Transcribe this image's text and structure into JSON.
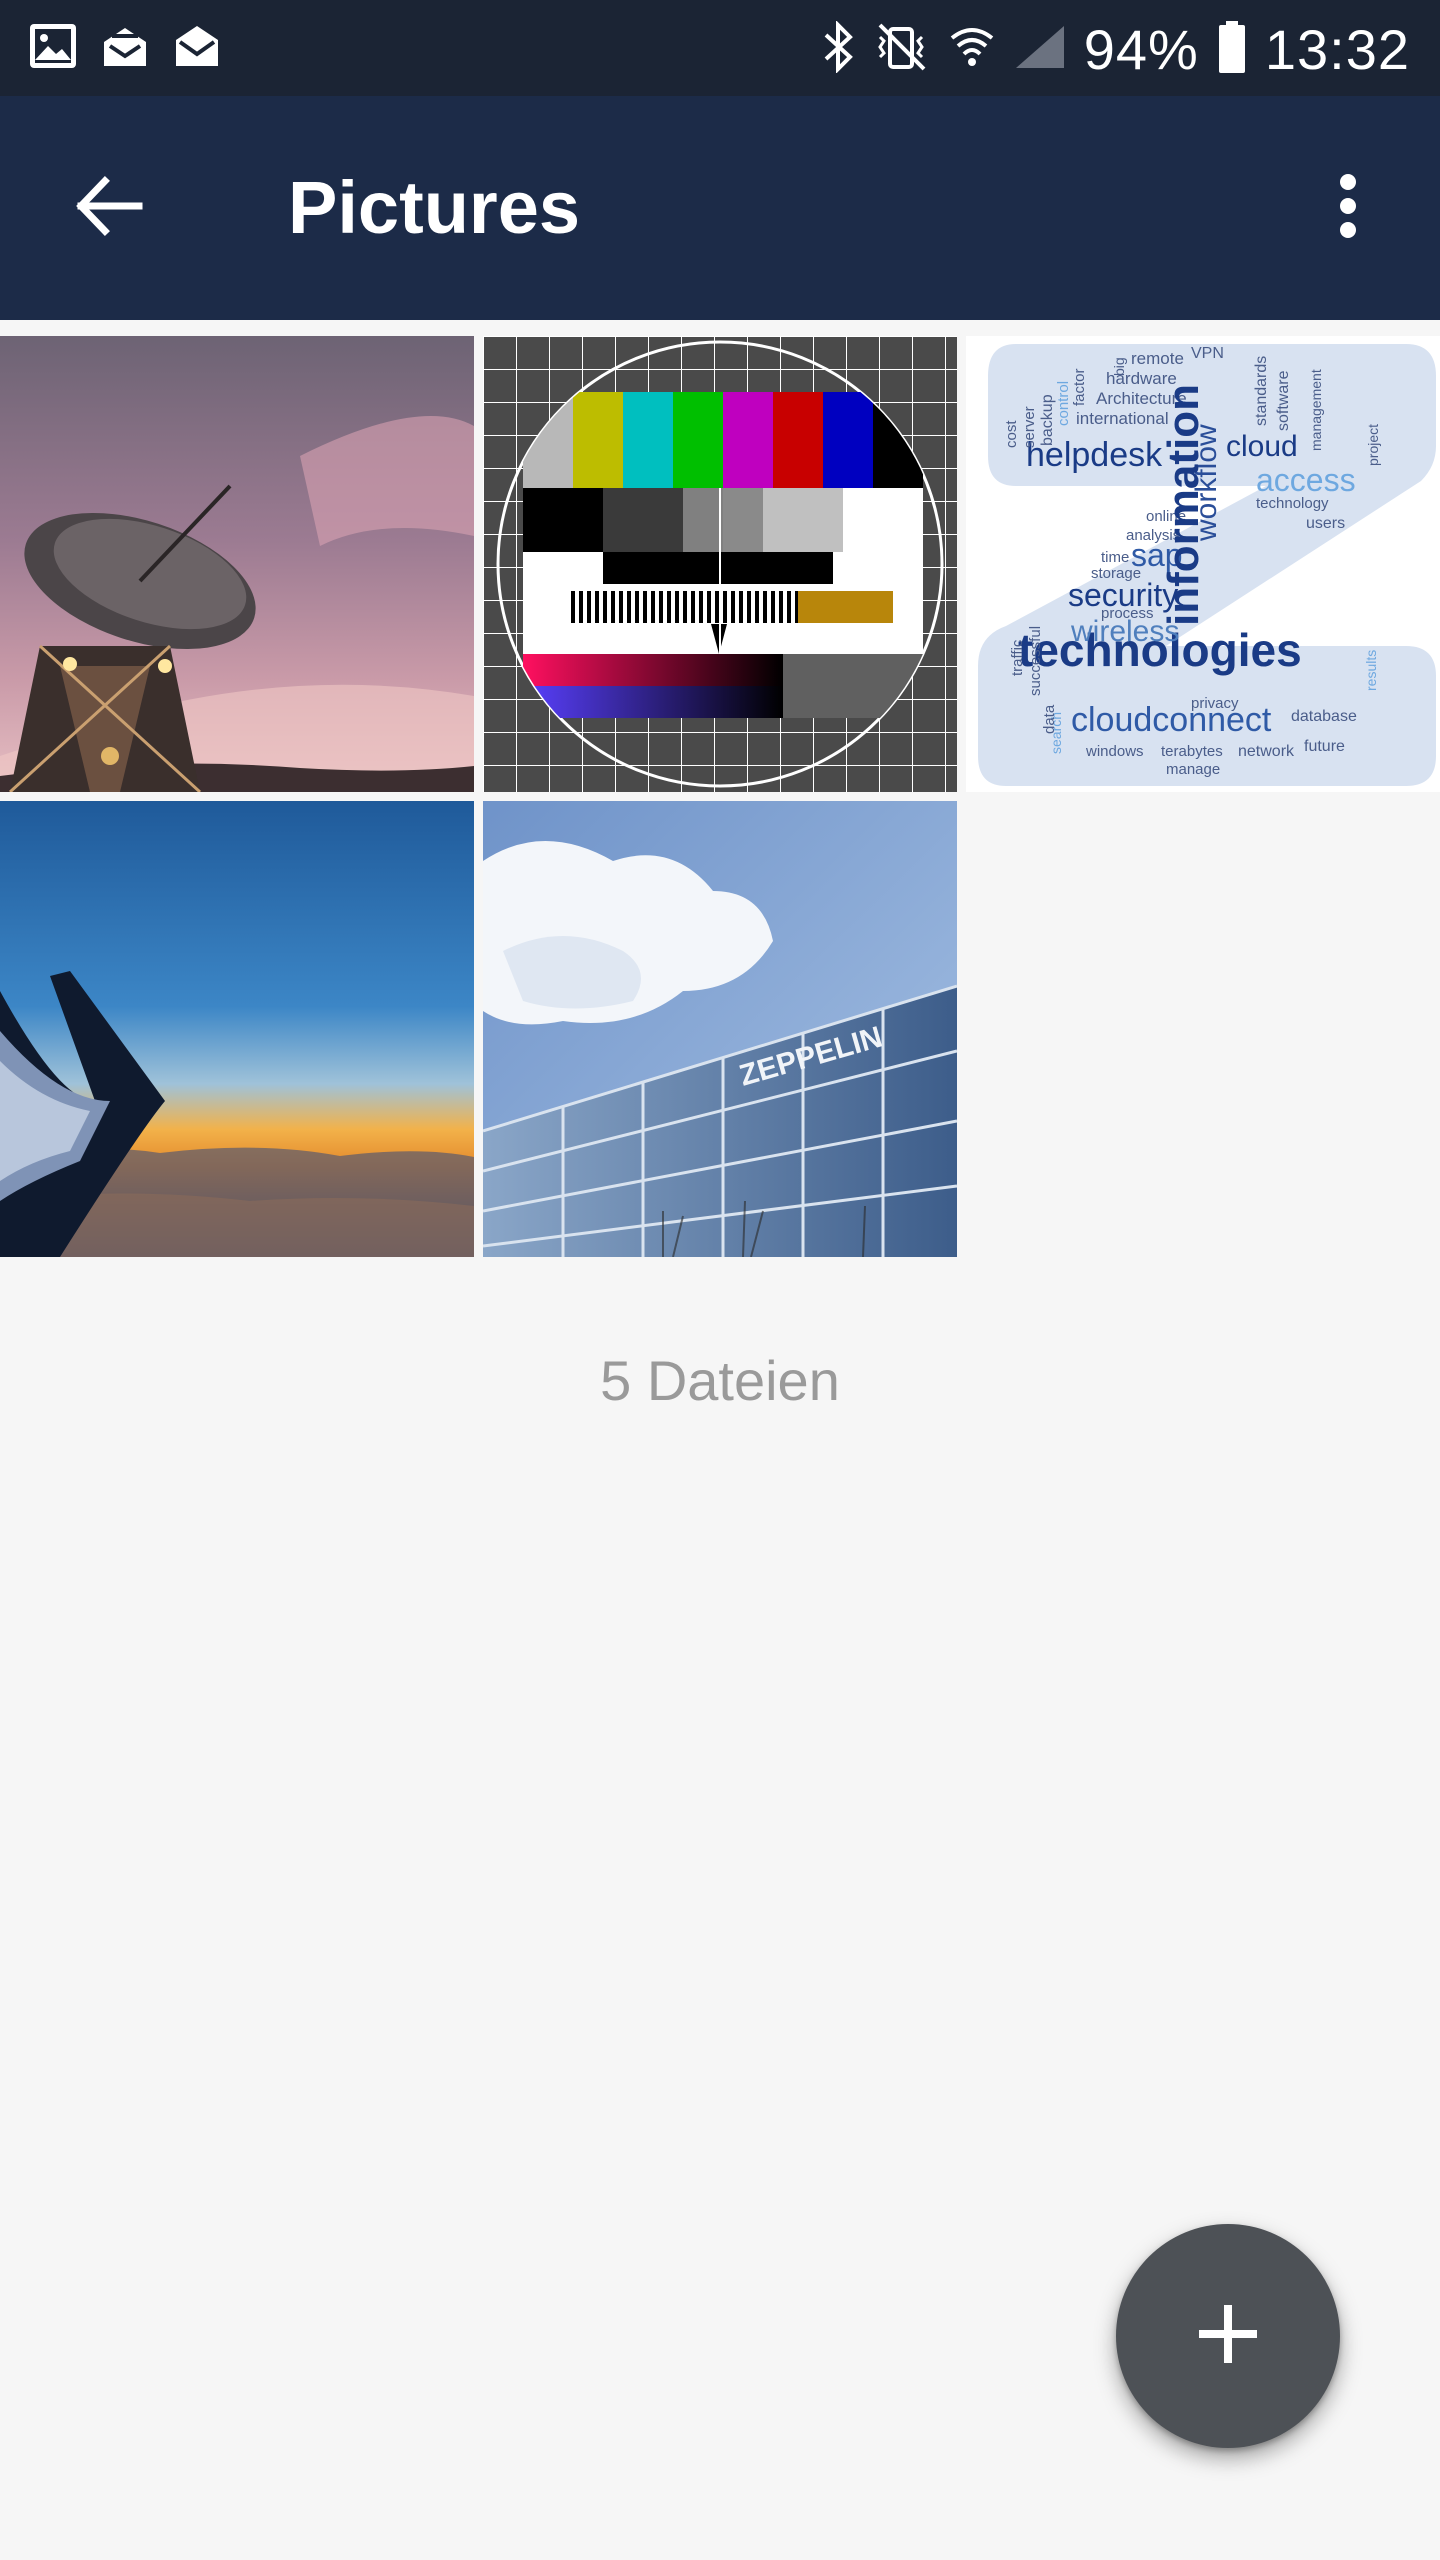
{
  "status_bar": {
    "battery": "94%",
    "time": "13:32",
    "left_icons": [
      "gallery-icon",
      "mail-stack-icon",
      "mail-open-icon"
    ],
    "right_icons": [
      "bluetooth-icon",
      "vibrate-mute-icon",
      "wifi-icon",
      "signal-icon",
      "battery-icon"
    ]
  },
  "app_bar": {
    "title": "Pictures",
    "back_icon": "arrow-left-icon",
    "overflow_icon": "more-vert-icon",
    "background": "#1c2b48"
  },
  "grid": {
    "items": [
      {
        "name": "radio-telescope"
      },
      {
        "name": "tv-test-pattern"
      },
      {
        "name": "word-cloud"
      },
      {
        "name": "airplane-wing"
      },
      {
        "name": "zeppelin-building"
      }
    ],
    "word_cloud_text": {
      "main_a": "technologies",
      "main_b": "information",
      "main_c": "cloudconnect",
      "w1": "helpdesk",
      "w2": "access",
      "w3": "security",
      "w4": "wireless",
      "w5": "cloud",
      "w6": "workflow",
      "w7": "sap",
      "w8": "Architecture",
      "w9": "hardware",
      "w10": "remote",
      "w11": "VPN",
      "w12": "international",
      "w13": "standards",
      "w14": "software",
      "w15": "database",
      "w16": "network",
      "w17": "future",
      "w18": "windows",
      "w19": "terabytes",
      "w20": "manage",
      "w21": "privacy",
      "w22": "process",
      "w23": "users",
      "w24": "technology",
      "w25": "online",
      "w26": "analysis",
      "w27": "storage",
      "w28": "time",
      "w29": "results",
      "w30": "project",
      "w31": "successful",
      "w32": "traffic",
      "w33": "search",
      "w34": "backup",
      "w35": "server",
      "w36": "cost",
      "w37": "big",
      "w38": "factor",
      "w39": "control",
      "w40": "management",
      "w41": "data"
    },
    "building_sign": "ZEPPELIN"
  },
  "file_count": "5 Dateien",
  "fab": {
    "icon": "plus-icon",
    "color": "#4d5156"
  }
}
